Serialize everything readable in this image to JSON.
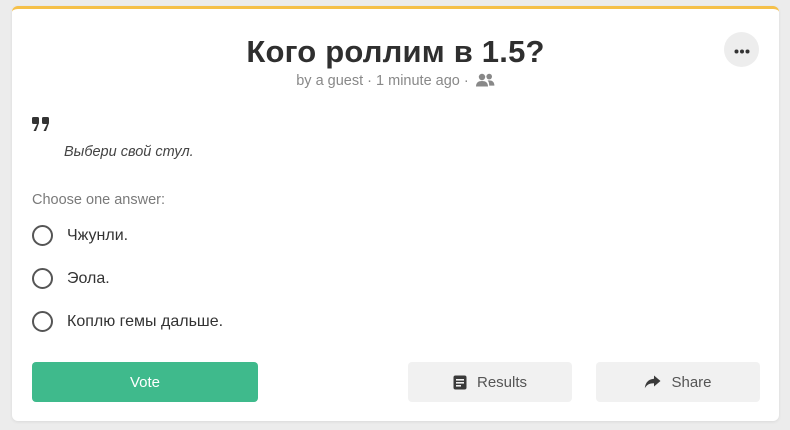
{
  "poll": {
    "title": "Кого роллим в 1.5?",
    "meta": "by a guest · 1 minute ago ·",
    "description": "Выбери свой стул.",
    "prompt": "Choose one answer:",
    "options": [
      {
        "label": "Чжунли."
      },
      {
        "label": "Эола."
      },
      {
        "label": "Коплю гемы дальше."
      }
    ]
  },
  "actions": {
    "vote_label": "Vote",
    "results_label": "Results",
    "share_label": "Share"
  },
  "icons": {
    "menu": "more-horizontal-icon",
    "audience": "users-icon",
    "quote": "quote-icon",
    "results": "document-list-icon",
    "share": "share-arrow-icon"
  },
  "colors": {
    "accent_top": "#f5c049",
    "vote": "#3fba8c",
    "secondary_button": "#f1f1f1",
    "background": "#ececec"
  }
}
